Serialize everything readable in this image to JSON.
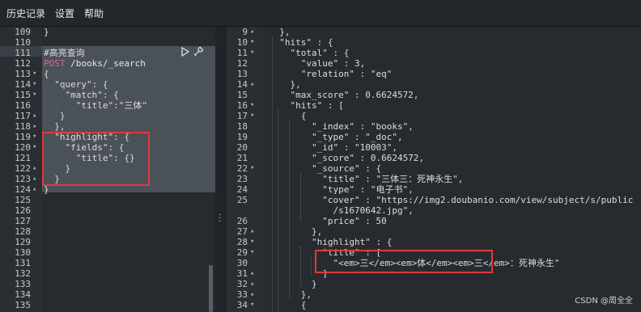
{
  "menu": {
    "history": "历史记录",
    "settings": "设置",
    "help": "帮助"
  },
  "left": {
    "lines": [
      {
        "n": "109",
        "fold": "",
        "text": "}"
      },
      {
        "n": "110",
        "fold": "",
        "text": ""
      },
      {
        "n": "111",
        "fold": "",
        "text": "#高亮查询"
      },
      {
        "n": "112",
        "fold": "",
        "method": "POST",
        "text": " /books/_search"
      },
      {
        "n": "113",
        "fold": "▾",
        "text": "{"
      },
      {
        "n": "114",
        "fold": "▾",
        "text": "  \"query\": {"
      },
      {
        "n": "115",
        "fold": "▾",
        "text": "    \"match\": {"
      },
      {
        "n": "116",
        "fold": "",
        "text": "      \"title\":\"三体\""
      },
      {
        "n": "117",
        "fold": "▴",
        "text": "   }"
      },
      {
        "n": "118",
        "fold": "▴",
        "text": "  },"
      },
      {
        "n": "119",
        "fold": "▾",
        "text": "  \"highlight\": {"
      },
      {
        "n": "120",
        "fold": "▾",
        "text": "    \"fields\": {"
      },
      {
        "n": "121",
        "fold": "",
        "text": "      \"title\": {}"
      },
      {
        "n": "122",
        "fold": "▴",
        "text": "    }"
      },
      {
        "n": "123",
        "fold": "▴",
        "text": "  }"
      },
      {
        "n": "124",
        "fold": "▴",
        "text": "}"
      },
      {
        "n": "125",
        "fold": "",
        "text": ""
      },
      {
        "n": "126",
        "fold": "",
        "text": ""
      },
      {
        "n": "127",
        "fold": "",
        "text": ""
      },
      {
        "n": "128",
        "fold": "",
        "text": ""
      },
      {
        "n": "129",
        "fold": "",
        "text": ""
      },
      {
        "n": "130",
        "fold": "",
        "text": ""
      },
      {
        "n": "131",
        "fold": "",
        "text": ""
      },
      {
        "n": "132",
        "fold": "",
        "text": ""
      },
      {
        "n": "133",
        "fold": "",
        "text": ""
      },
      {
        "n": "134",
        "fold": "",
        "text": ""
      },
      {
        "n": "135",
        "fold": "",
        "text": ""
      }
    ]
  },
  "right": {
    "lines": [
      {
        "n": "9",
        "fold": "▴",
        "text": "  },"
      },
      {
        "n": "10",
        "fold": "▾",
        "text": "  \"hits\" : {"
      },
      {
        "n": "11",
        "fold": "▾",
        "text": "    \"total\" : {"
      },
      {
        "n": "12",
        "fold": "",
        "text": "      \"value\" : 3,"
      },
      {
        "n": "13",
        "fold": "",
        "text": "      \"relation\" : \"eq\""
      },
      {
        "n": "14",
        "fold": "▴",
        "text": "    },"
      },
      {
        "n": "15",
        "fold": "",
        "text": "    \"max_score\" : 0.6624572,"
      },
      {
        "n": "16",
        "fold": "▾",
        "text": "    \"hits\" : ["
      },
      {
        "n": "17",
        "fold": "▾",
        "text": "      {"
      },
      {
        "n": "18",
        "fold": "",
        "text": "        \"_index\" : \"books\","
      },
      {
        "n": "19",
        "fold": "",
        "text": "        \"_type\" : \"_doc\","
      },
      {
        "n": "20",
        "fold": "",
        "text": "        \"_id\" : \"10003\","
      },
      {
        "n": "21",
        "fold": "",
        "text": "        \"_score\" : 0.6624572,"
      },
      {
        "n": "22",
        "fold": "▾",
        "text": "        \"_source\" : {"
      },
      {
        "n": "23",
        "fold": "",
        "text": "          \"title\" : \"三体三：死神永生\","
      },
      {
        "n": "24",
        "fold": "",
        "text": "          \"type\" : \"电子书\","
      },
      {
        "n": "25",
        "fold": "",
        "text": "          \"cover\" : \"https://img2.doubanio.com/view/subject/s/public"
      },
      {
        "n": "",
        "fold": "",
        "text": "            /s1670642.jpg\","
      },
      {
        "n": "26",
        "fold": "",
        "text": "          \"price\" : 50"
      },
      {
        "n": "27",
        "fold": "▴",
        "text": "        },"
      },
      {
        "n": "28",
        "fold": "▾",
        "text": "        \"highlight\" : {"
      },
      {
        "n": "29",
        "fold": "▾",
        "text": "          \"title\" : ["
      },
      {
        "n": "30",
        "fold": "",
        "text": "            \"<em>三</em><em>体</em><em>三</em>：死神永生\""
      },
      {
        "n": "31",
        "fold": "▴",
        "text": "          ]"
      },
      {
        "n": "32",
        "fold": "▴",
        "text": "        }"
      },
      {
        "n": "33",
        "fold": "▴",
        "text": "      },"
      },
      {
        "n": "34",
        "fold": "▾",
        "text": "      {"
      }
    ]
  },
  "watermark": "CSDN @周全全",
  "colors": {
    "accent_red": "#e03a3a",
    "post_method": "#d66a9a"
  }
}
